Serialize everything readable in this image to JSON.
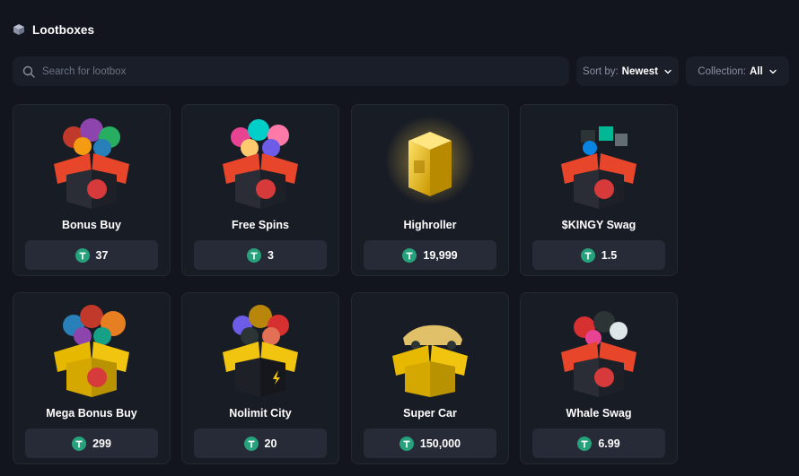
{
  "header": {
    "title": "Lootboxes",
    "icon": "cube-icon"
  },
  "search": {
    "placeholder": "Search for lootbox",
    "value": ""
  },
  "sort": {
    "label": "Sort by:",
    "value": "Newest"
  },
  "collection": {
    "label": "Collection:",
    "value": "All"
  },
  "colors": {
    "background": "#12151d",
    "card": "#181c25",
    "price_pill": "#262b37",
    "coin": "#26a17b",
    "orange_box": "#e8462a",
    "gold_box": "#e6b800"
  },
  "lootboxes": [
    {
      "name": "Bonus Buy",
      "price": "37",
      "box_color": "orange",
      "box_icon": "bonus-buy-box-icon"
    },
    {
      "name": "Free Spins",
      "price": "3",
      "box_color": "orange",
      "box_icon": "free-spins-box-icon"
    },
    {
      "name": "Highroller",
      "price": "19,999",
      "box_color": "gold",
      "box_icon": "highroller-cube-icon"
    },
    {
      "name": "$KINGY Swag",
      "price": "1.5",
      "box_color": "orange",
      "box_icon": "kingy-swag-box-icon"
    },
    {
      "name": "Mega Bonus Buy",
      "price": "299",
      "box_color": "gold",
      "box_icon": "mega-bonus-buy-box-icon"
    },
    {
      "name": "Nolimit City",
      "price": "20",
      "box_color": "gold",
      "box_icon": "nolimit-city-box-icon"
    },
    {
      "name": "Super Car",
      "price": "150,000",
      "box_color": "gold",
      "box_icon": "super-car-box-icon"
    },
    {
      "name": "Whale Swag",
      "price": "6.99",
      "box_color": "orange",
      "box_icon": "whale-swag-box-icon"
    }
  ]
}
